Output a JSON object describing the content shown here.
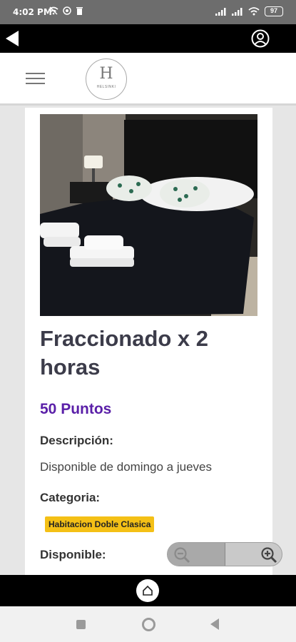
{
  "status_bar": {
    "time": "4:02 PM",
    "battery": "97",
    "icons": [
      "wifi-off-icon",
      "settings-icon",
      "trash-icon",
      "signal-icon",
      "signal-icon",
      "wifi-icon",
      "battery-icon"
    ]
  },
  "app_bar": {
    "back_icon": "back-arrow-icon",
    "account_icon": "account-circle-icon"
  },
  "header": {
    "menu_icon": "hamburger-menu-icon",
    "logo_letter": "H",
    "logo_brand": "HELSINKI"
  },
  "product": {
    "title": "Fraccionado x 2 horas",
    "points": "50 Puntos",
    "description_label": "Descripción:",
    "description": "Disponible de domingo a jueves",
    "category_label": "Categoria:",
    "category": "Habitacion Doble Clasica",
    "available_label": "Disponible:",
    "badge_color": "#f4c016",
    "points_color": "#5a1fa8"
  },
  "zoom_control": {
    "zoom_out_icon": "zoom-out-icon",
    "zoom_in_icon": "zoom-in-icon"
  },
  "bottom_bar": {
    "home_icon": "home-icon"
  },
  "system_nav": {
    "items": [
      "recents-icon",
      "home-circle-icon",
      "back-triangle-icon"
    ]
  }
}
